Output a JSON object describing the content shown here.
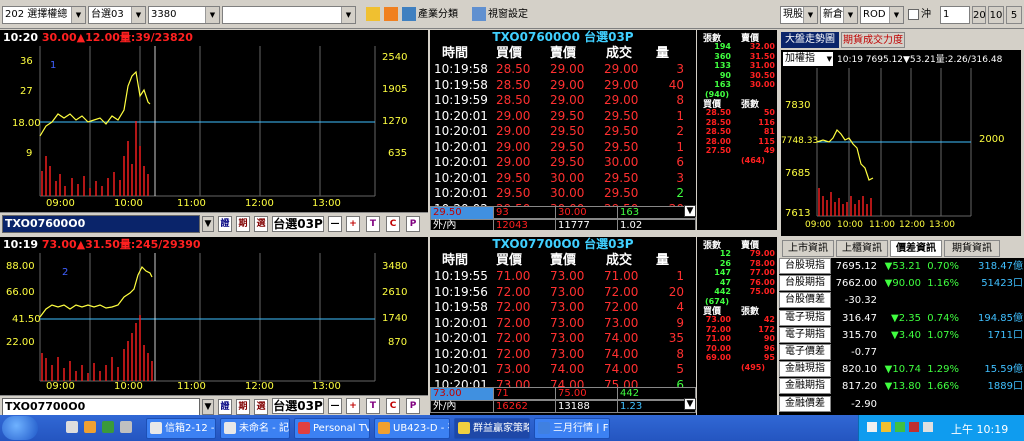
{
  "toolbar": {
    "group_combo": "202 選擇權總",
    "board_combo": "台選03",
    "code_combo": "3380",
    "empty_combo": "",
    "industry_btn": "產業分類",
    "window_btn": "視窗設定",
    "order_type": "現股",
    "order_action": "新倉",
    "order_cond": "ROD",
    "order_dir": "沖",
    "qty": "1",
    "q1": "20",
    "q2": "10",
    "q3": "5"
  },
  "chart1": {
    "time": "10:20",
    "price": "30.00",
    "change": "▲12.00",
    "vol": "量:39/23820",
    "ref_price": "18.00",
    "left_ticks": [
      "36",
      "27",
      "9"
    ],
    "right_ticks": [
      "2540",
      "1905",
      "1270",
      "635"
    ],
    "x_ticks": [
      "09:00",
      "10:00",
      "11:00",
      "12:00",
      "13:00"
    ],
    "marker": "1",
    "symbol": "TXO07600O0",
    "board": "台選03P",
    "ctrl": [
      "證",
      "期",
      "選"
    ],
    "ops": [
      "—",
      "+",
      "T",
      "C",
      "P"
    ]
  },
  "chart2": {
    "time": "10:19",
    "price": "73.00",
    "change": "▲31.50",
    "vol": "量:245/29390",
    "ref_price": "41.50",
    "left_ticks": [
      "88.00",
      "66.00",
      "22.00"
    ],
    "right_ticks": [
      "3480",
      "2610",
      "1740",
      "870"
    ],
    "x_ticks": [
      "09:00",
      "10:00",
      "11:00",
      "12:00",
      "13:00"
    ],
    "marker": "2",
    "symbol": "TXO07700O0",
    "board": "台選03P",
    "ctrl": [
      "證",
      "期",
      "選"
    ],
    "ops": [
      "—",
      "+",
      "T",
      "C",
      "P"
    ]
  },
  "tape1": {
    "title": "TXO07600O0 台選03P",
    "headers": [
      "時間",
      "買價",
      "賣價",
      "成交",
      "量"
    ],
    "rows": [
      [
        "10:19:58",
        "28.50",
        "29.00",
        "29.00",
        "3"
      ],
      [
        "10:19:58",
        "28.50",
        "29.00",
        "29.00",
        "40"
      ],
      [
        "10:19:59",
        "28.50",
        "29.00",
        "29.00",
        "8"
      ],
      [
        "10:20:01",
        "29.00",
        "29.50",
        "29.50",
        "1"
      ],
      [
        "10:20:01",
        "29.00",
        "29.50",
        "29.50",
        "2"
      ],
      [
        "10:20:01",
        "29.00",
        "29.50",
        "29.50",
        "1"
      ],
      [
        "10:20:01",
        "29.00",
        "29.50",
        "30.00",
        "6"
      ],
      [
        "10:20:01",
        "29.50",
        "30.00",
        "29.50",
        "3"
      ],
      [
        "10:20:01",
        "29.50",
        "30.00",
        "29.50",
        "2"
      ],
      [
        "10:20:02",
        "29.50",
        "30.00",
        "29.50",
        "20"
      ]
    ],
    "sum1": [
      "29.50",
      "93",
      "30.00",
      "163"
    ],
    "sum2": [
      "外/內",
      "12043",
      "11777",
      "1.02"
    ]
  },
  "tape2": {
    "title": "TXO07700O0 台選03P",
    "headers": [
      "時間",
      "買價",
      "賣價",
      "成交",
      "量"
    ],
    "rows": [
      [
        "10:19:55",
        "71.00",
        "73.00",
        "71.00",
        "1"
      ],
      [
        "10:19:56",
        "72.00",
        "73.00",
        "72.00",
        "20"
      ],
      [
        "10:19:58",
        "72.00",
        "73.00",
        "72.00",
        "4"
      ],
      [
        "10:20:01",
        "72.00",
        "73.00",
        "73.00",
        "9"
      ],
      [
        "10:20:01",
        "72.00",
        "73.00",
        "74.00",
        "35"
      ],
      [
        "10:20:01",
        "72.00",
        "73.00",
        "74.00",
        "8"
      ],
      [
        "10:20:01",
        "73.00",
        "74.00",
        "74.00",
        "5"
      ],
      [
        "10:20:01",
        "73.00",
        "74.00",
        "75.00",
        "6"
      ],
      [
        "10:20:02",
        "73.00",
        "74.00",
        "75.00",
        "2"
      ]
    ],
    "sum1": [
      "73.00",
      "71",
      "75.00",
      "442"
    ],
    "sum2": [
      "外/內",
      "16262",
      "13188",
      "1.23"
    ]
  },
  "book1": {
    "h1": "張數",
    "h2": "賣價",
    "h3": "買價",
    "h4": "張數",
    "ask": [
      [
        "194",
        "32.00"
      ],
      [
        "360",
        "31.50"
      ],
      [
        "133",
        "31.00"
      ],
      [
        "90",
        "30.50"
      ],
      [
        "163",
        "30.00"
      ]
    ],
    "ask_total": "(940)",
    "bid": [
      [
        "28.50",
        "50"
      ],
      [
        "28.50",
        "116"
      ],
      [
        "28.50",
        "81"
      ],
      [
        "28.00",
        "115"
      ],
      [
        "27.50",
        "49"
      ]
    ],
    "bid_total": "(464)"
  },
  "book2": {
    "h1": "張數",
    "h2": "賣價",
    "h3": "買價",
    "h4": "張數",
    "ask": [
      [
        "12",
        "79.00"
      ],
      [
        "26",
        "78.00"
      ],
      [
        "147",
        "77.00"
      ],
      [
        "47",
        "76.00"
      ],
      [
        "442",
        "75.00"
      ]
    ],
    "ask_total": "(674)",
    "bid": [
      [
        "73.00",
        "42"
      ],
      [
        "72.00",
        "172"
      ],
      [
        "71.00",
        "90"
      ],
      [
        "70.00",
        "96"
      ],
      [
        "69.00",
        "95"
      ]
    ],
    "bid_total": "(495)"
  },
  "mini_chart": {
    "tab1": "大盤走勢圖",
    "tab2": "期貨成交力度",
    "combo": "加權指",
    "info": "10:19 7695.12▼53.21量:2.26/316.48",
    "ref": "7748.33",
    "left_ticks": [
      "7830",
      "7685",
      "7613"
    ],
    "right_ticks": [
      "2000"
    ],
    "x_ticks": [
      "09:00",
      "10:00",
      "11:00",
      "12:00",
      "13:00"
    ]
  },
  "futures": {
    "tabs": [
      "上市資訊",
      "上櫃資訊",
      "價差資訊",
      "期貨資訊"
    ],
    "rows": [
      {
        "name": "台股現指",
        "price": "7695.12",
        "chg": "▼53.21",
        "pct": "0.70%",
        "vol": "318.47億"
      },
      {
        "name": "台股期指",
        "price": "7662.00",
        "chg": "▼90.00",
        "pct": "1.16%",
        "vol": "51423口"
      },
      {
        "name": "台股價差",
        "price": "-30.32",
        "chg": "",
        "pct": "",
        "vol": ""
      },
      {
        "name": "電子現指",
        "price": "316.47",
        "chg": "▼2.35",
        "pct": "0.74%",
        "vol": "194.85億"
      },
      {
        "name": "電子期指",
        "price": "315.70",
        "chg": "▼3.40",
        "pct": "1.07%",
        "vol": "1711口"
      },
      {
        "name": "電子價差",
        "price": "-0.77",
        "chg": "",
        "pct": "",
        "vol": ""
      },
      {
        "name": "金融現指",
        "price": "820.10",
        "chg": "▼10.74",
        "pct": "1.29%",
        "vol": "15.59億"
      },
      {
        "name": "金融期指",
        "price": "817.20",
        "chg": "▼13.80",
        "pct": "1.66%",
        "vol": "1889口"
      },
      {
        "name": "金融價差",
        "price": "-2.90",
        "chg": "",
        "pct": "",
        "vol": ""
      }
    ]
  },
  "taskbar": {
    "items": [
      "信箱2-12 - 記...",
      "未命名 - 記事本",
      "Personal TV A...",
      "UB423-D - 有...",
      "群益贏家策略王",
      "三月行情 | FRE..."
    ],
    "clock": "上午 10:19"
  }
}
